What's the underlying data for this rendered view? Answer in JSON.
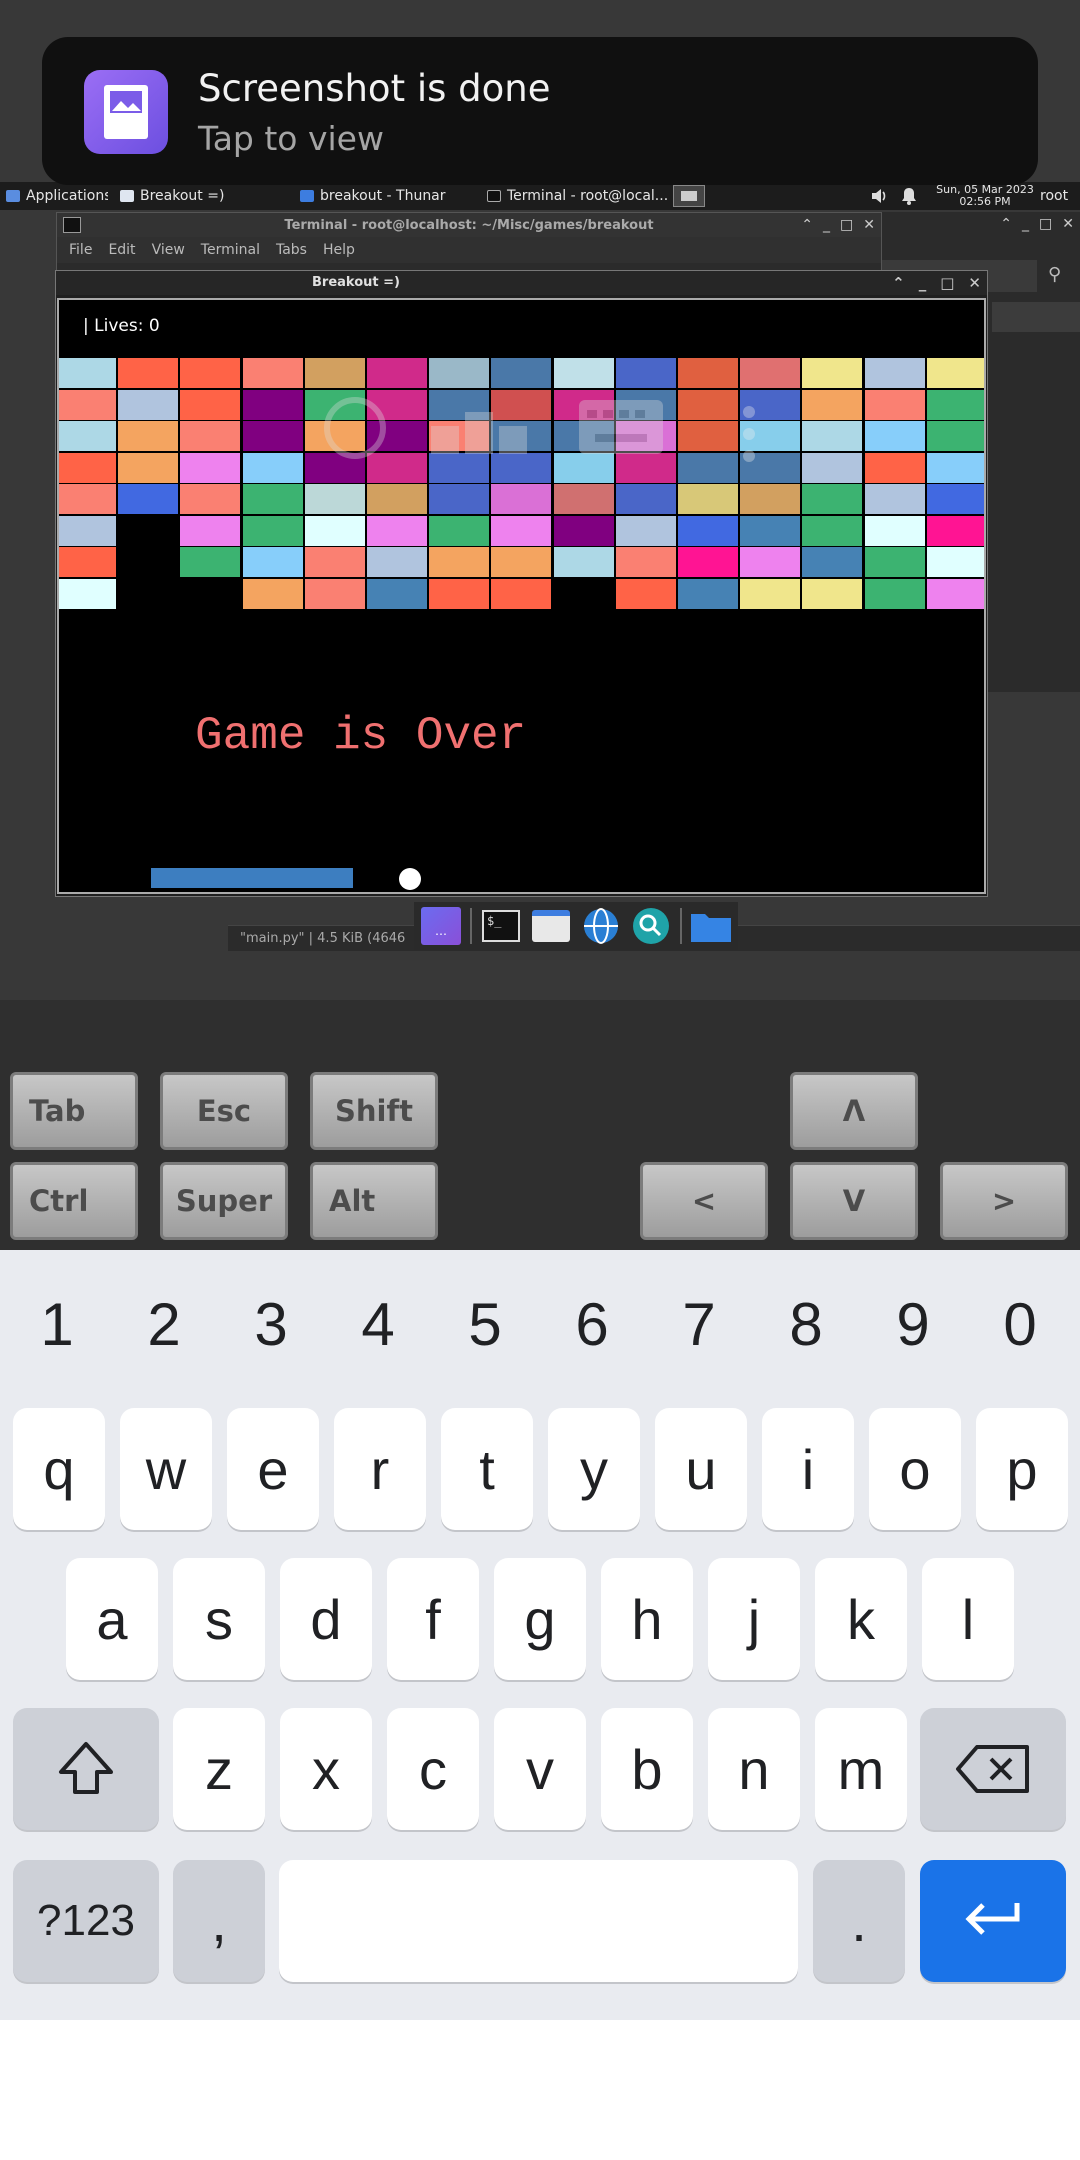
{
  "notification": {
    "title": "Screenshot is done",
    "subtitle": "Tap to view"
  },
  "taskbar": {
    "apps_menu": "Applications",
    "items": [
      "Breakout =)",
      "breakout - Thunar",
      "Terminal - root@local..."
    ],
    "clock_date": "Sun, 05 Mar 2023",
    "clock_time": "02:56 PM",
    "user": "root"
  },
  "terminal_window": {
    "title": "Terminal - root@localhost: ~/Misc/games/breakout",
    "menu": [
      "File",
      "Edit",
      "View",
      "Terminal",
      "Tabs",
      "Help"
    ]
  },
  "breakout_window": {
    "title": "Breakout =)",
    "lives_text": "| Lives: 0",
    "game_over_text": "Game is Over",
    "bricks": [
      [
        "#add8e6",
        "#ff6347",
        "#ff6347",
        "#fa8072",
        "#d2a060",
        "#d02a8a",
        "#9ab8c8",
        "#4a78a8",
        "#c0e0e8",
        "#4a66c8",
        "#e06040",
        "#e07070",
        "#f0e68c",
        "#b0c4de",
        "#f0e68c"
      ],
      [
        "#fa8072",
        "#b0c4de",
        "#ff6347",
        "#800080",
        "#3cb371",
        "#d02a8a",
        "#4a78a8",
        "#d05050",
        "#d02a8a",
        "#4a78a8",
        "#e06040",
        "#4a66c8",
        "#f4a460",
        "#fa8072",
        "#3cb371"
      ],
      [
        "#add8e6",
        "#f4a460",
        "#fa8072",
        "#800080",
        "#f4a460",
        "#800080",
        "#fa8072",
        "#4a78a8",
        "#4a78a8",
        "#da70d6",
        "#e06040",
        "#87ceeb",
        "#add8e6",
        "#87cefa",
        "#3cb371"
      ],
      [
        "#ff6347",
        "#f4a460",
        "#ee82ee",
        "#87cefa",
        "#800080",
        "#d02a8a",
        "#4a66c8",
        "#4a66c8",
        "#87ceeb",
        "#d02a8a",
        "#4a78a8",
        "#4a78a8",
        "#b0c4de",
        "#ff6347",
        "#87cefa"
      ],
      [
        "#fa8072",
        "#4169e1",
        "#fa8072",
        "#3cb371",
        "#bcd8d8",
        "#d2a060",
        "#4a66c8",
        "#da70d6",
        "#d07070",
        "#4a66c8",
        "#d8c878",
        "#d2a060",
        "#3cb371",
        "#b0c4de",
        "#4169e1"
      ],
      [
        "#b0c4de",
        null,
        "#ee82ee",
        "#3cb371",
        "#e0ffff",
        "#ee82ee",
        "#3cb371",
        "#ee82ee",
        "#800080",
        "#b0c4de",
        "#4169e1",
        "#4682b4",
        "#3cb371",
        "#e0ffff",
        "#ff1493"
      ],
      [
        "#ff6347",
        null,
        "#3cb371",
        "#87cefa",
        "#fa8072",
        "#b0c4de",
        "#f4a460",
        "#f4a460",
        "#add8e6",
        "#fa8072",
        "#ff1493",
        "#ee82ee",
        "#4682b4",
        "#3cb371",
        "#e0ffff"
      ],
      [
        "#e0ffff",
        null,
        null,
        "#f4a460",
        "#fa8072",
        "#4682b4",
        "#ff6347",
        "#ff6347",
        null,
        "#ff6347",
        "#4682b4",
        "#f0e68c",
        "#f0e68c",
        "#3cb371",
        "#ee82ee"
      ]
    ]
  },
  "file_status": "\"main.py\"  |  4.5 KiB (4646",
  "dock": {
    "icons": [
      "desktop-icon",
      "terminal-icon",
      "file-manager-icon",
      "browser-icon",
      "search-icon",
      "folder-icon"
    ]
  },
  "extra_keys": {
    "row1": [
      "Tab",
      "Esc",
      "Shift",
      "Λ"
    ],
    "row2": [
      "Ctrl",
      "Super",
      "Alt",
      "<",
      "V",
      ">"
    ]
  },
  "keyboard": {
    "numbers": [
      "1",
      "2",
      "3",
      "4",
      "5",
      "6",
      "7",
      "8",
      "9",
      "0"
    ],
    "row1": [
      "q",
      "w",
      "e",
      "r",
      "t",
      "y",
      "u",
      "i",
      "o",
      "p"
    ],
    "row2": [
      "a",
      "s",
      "d",
      "f",
      "g",
      "h",
      "j",
      "k",
      "l"
    ],
    "row3": [
      "z",
      "x",
      "c",
      "v",
      "b",
      "n",
      "m"
    ],
    "symbols_label": "?123",
    "comma": ",",
    "period": "."
  }
}
